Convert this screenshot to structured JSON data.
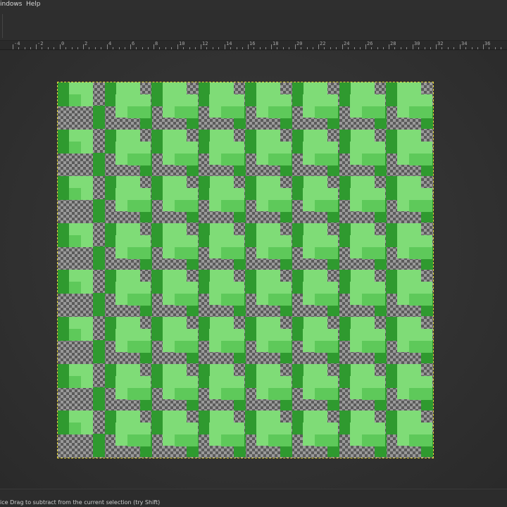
{
  "menu": {
    "windows_label": "indows",
    "help_label": "Help"
  },
  "ruler": {
    "labels": [
      "-4",
      "-2",
      "0",
      "2",
      "4",
      "6",
      "8",
      "10",
      "12",
      "14",
      "16",
      "18",
      "20",
      "22",
      "24",
      "26",
      "28",
      "30",
      "32",
      "34",
      "36"
    ]
  },
  "canvas": {
    "pattern": "tiled green isometric blocks over transparency checkerboard",
    "colors": {
      "light_green": "#7fdc77",
      "mid_green": "#5ec95a",
      "dark_green": "#2f9a2f",
      "selection_border": "#e6d53a"
    }
  },
  "status": {
    "message": "ice Drag to subtract from the current selection (try Shift)"
  }
}
